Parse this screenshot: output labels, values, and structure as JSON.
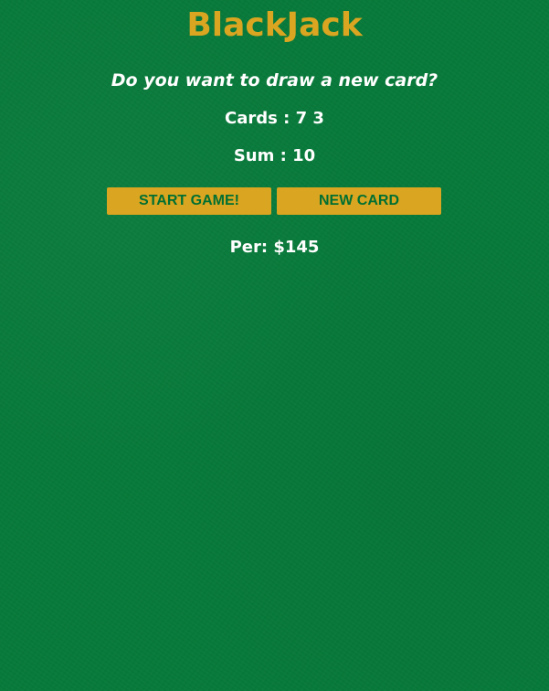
{
  "title": "BlackJack",
  "message": "Do you want to draw a new card?",
  "cards": {
    "label": "Cards : ",
    "values": "7 3"
  },
  "sum": {
    "label": "Sum : ",
    "value": "10"
  },
  "buttons": {
    "start_label": "START GAME!",
    "new_card_label": "NEW CARD"
  },
  "player": {
    "name": "Per",
    "separator": ": ",
    "chips": "$145"
  },
  "colors": {
    "table_felt": "#077a3a",
    "accent_gold": "#daa520",
    "button_text": "#016f32",
    "text": "#ffffff"
  }
}
